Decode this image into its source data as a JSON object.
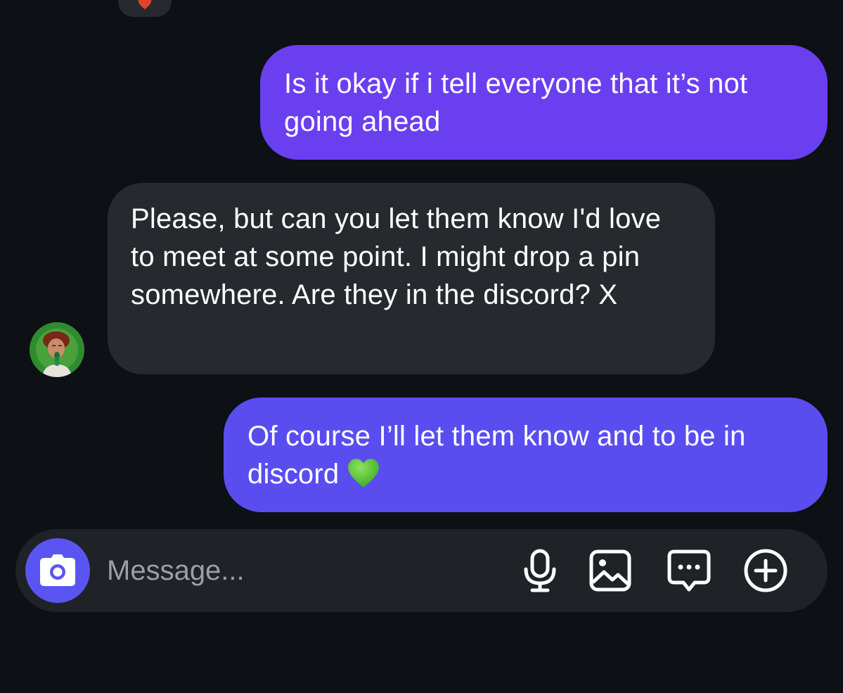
{
  "thread": {
    "messages": [
      {
        "direction": "outgoing",
        "text": "Is it okay if i tell everyone that it’s not going ahead"
      },
      {
        "direction": "incoming",
        "text": "Please, but can you let them know I'd love to meet at some point. I might drop a pin somewhere. Are they in the discord? X"
      },
      {
        "direction": "outgoing",
        "text": "Of course I’ll let them know and to be in discord",
        "emoji": "green-heart-emoji"
      }
    ]
  },
  "composer": {
    "placeholder": "Message...",
    "value": "",
    "icons": [
      "camera-icon",
      "microphone-icon",
      "gallery-icon",
      "sticker-chat-icon",
      "plus-circle-icon"
    ]
  },
  "colors": {
    "background": "#0d1014",
    "outgoing_bubble_top": "#6a3ff0",
    "outgoing_bubble_bottom": "#5a4df0",
    "incoming_bubble": "#262a2f",
    "composer": "#1f2226",
    "camera_button": "#5a55f2",
    "reaction_heart": "#e0452b",
    "green_heart": "#5ecb3a"
  }
}
